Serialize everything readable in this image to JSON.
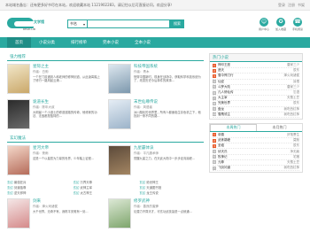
{
  "topbar": {
    "notice": "本站域名备忘：还有更多好书尽在本站，欢迎收藏本站 1121902283，请记住以后可直接访问，欢迎分享！",
    "links": [
      "登录",
      "注册",
      "书架"
    ]
  },
  "header": {
    "logo_text": "文学馆",
    "logo_sub": "READ.LIB",
    "search_select": "书名",
    "search_placeholder": "",
    "search_button": "搜索",
    "icons": [
      {
        "name": "user-icon",
        "label": "用户中心",
        "glyph": "☺"
      },
      {
        "name": "weibo-icon",
        "label": "加入收藏",
        "glyph": "✪"
      },
      {
        "name": "phone-icon",
        "label": "手机阅读",
        "glyph": "☎"
      }
    ]
  },
  "nav": {
    "items": [
      "首页",
      "小说分类",
      "排行榜单",
      "完本小说",
      "全本小说"
    ]
  },
  "featured": {
    "title": "强力推荐",
    "books": [
      {
        "title": "星际之主",
        "author": "作者：白驹",
        "desc": "一个在门前遇到人和老师的修神剑道，从此凌霄踏上了修行一路风起云涌...",
        "cover": [
          "#f1e6c8",
          "#caa86a"
        ]
      },
      {
        "title": "科技帝国系统",
        "author": "作者：青木",
        "desc": "快穿中国新时，现身在战场中，获取科学科技系统为了，改变历史今后事件的故事...",
        "cover": [
          "#dde7ef",
          "#7d98ad"
        ]
      },
      {
        "title": "诡道长生",
        "author": "作者：陈年大叔",
        "desc": "大明最一个小道士的修道道路的传奇，他修炼的功法、法宝都是独特的...",
        "cover": [
          "#2b2b2b",
          "#6b6b6b"
        ]
      },
      {
        "title": "末世仙尊传说",
        "author": "作者：风语者",
        "desc": "冰川融化的世界里，所有人都面临生存危机之下，他找到一条不同的路...",
        "cover": [
          "#e5edf5",
          "#9cb3c9"
        ]
      }
    ]
  },
  "rank": {
    "title": "热门小说",
    "items": [
      {
        "t": "神印王座",
        "a": "唐家三少"
      },
      {
        "t": "遮天",
        "a": "辰东"
      },
      {
        "t": "雪中悍刀行",
        "a": "烽火戏诸侯"
      },
      {
        "t": "仙逆",
        "a": "耳根"
      },
      {
        "t": "斗罗大陆",
        "a": "唐家三少"
      },
      {
        "t": "凡人修仙传",
        "a": "忘语"
      },
      {
        "t": "大主宰",
        "a": "天蚕土豆"
      },
      {
        "t": "完美世界",
        "a": "辰东"
      },
      {
        "t": "盘龙",
        "a": "我吃西红柿"
      },
      {
        "t": "雪鹰领主",
        "a": "我吃西红柿"
      }
    ]
  },
  "updates": {
    "title": "玄幻魔法",
    "books": [
      {
        "title": "星河大帝",
        "author": "作者：夜雨",
        "desc": "这是一个以星辰为力量的世界，少年踏上征程...",
        "cover": [
          "#f3d6c8",
          "#b56c5a"
        ]
      },
      {
        "title": "九星霸体诀",
        "author": "作者：平凡魔术师",
        "desc": "觉醒九星之力，在天武大陆中一步步走向巅峰...",
        "cover": [
          "#5c4a3a",
          "#a38562"
        ]
      }
    ],
    "links": [
      {
        "c": "玄幻",
        "t": "最强狂兵"
      },
      {
        "c": "玄幻",
        "t": "万界天尊"
      },
      {
        "c": "玄幻",
        "t": "绝世神王"
      },
      {
        "c": "玄幻",
        "t": "剑道独尊"
      },
      {
        "c": "玄幻",
        "t": "武神主宰"
      },
      {
        "c": "玄幻",
        "t": "天道图书馆"
      },
      {
        "c": "玄幻",
        "t": "逆天邪神"
      },
      {
        "c": "玄幻",
        "t": "太古神王"
      },
      {
        "c": "玄幻",
        "t": "龙王传说"
      }
    ]
  },
  "rank2": {
    "tabs": [
      "本周热门",
      "本月热门"
    ],
    "items": [
      {
        "t": "帝霸",
        "a": "厌笔萧生"
      },
      {
        "t": "武炼巅峰",
        "a": "莫默"
      },
      {
        "t": "圣墟",
        "a": "辰东"
      },
      {
        "t": "伏天氏",
        "a": "净无痕"
      },
      {
        "t": "牧神记",
        "a": "宅猪"
      },
      {
        "t": "元尊",
        "a": "天蚕土豆"
      },
      {
        "t": "飞剑问道",
        "a": "我吃西红柿"
      }
    ]
  },
  "updates2": {
    "books": [
      {
        "title": "剑来",
        "author": "作者：烽火戏诸侯",
        "desc": "大千世界，无奇不有，我陈平安唯有一剑...",
        "cover": [
          "#f4e6e6",
          "#d58a8a"
        ]
      },
      {
        "title": "修罗武神",
        "author": "作者：善良的蜜蜂",
        "desc": "论潜力不算天才，可玄功武技皆是一点就通...",
        "cover": [
          "#dce8d5",
          "#7ea56c"
        ]
      }
    ]
  }
}
